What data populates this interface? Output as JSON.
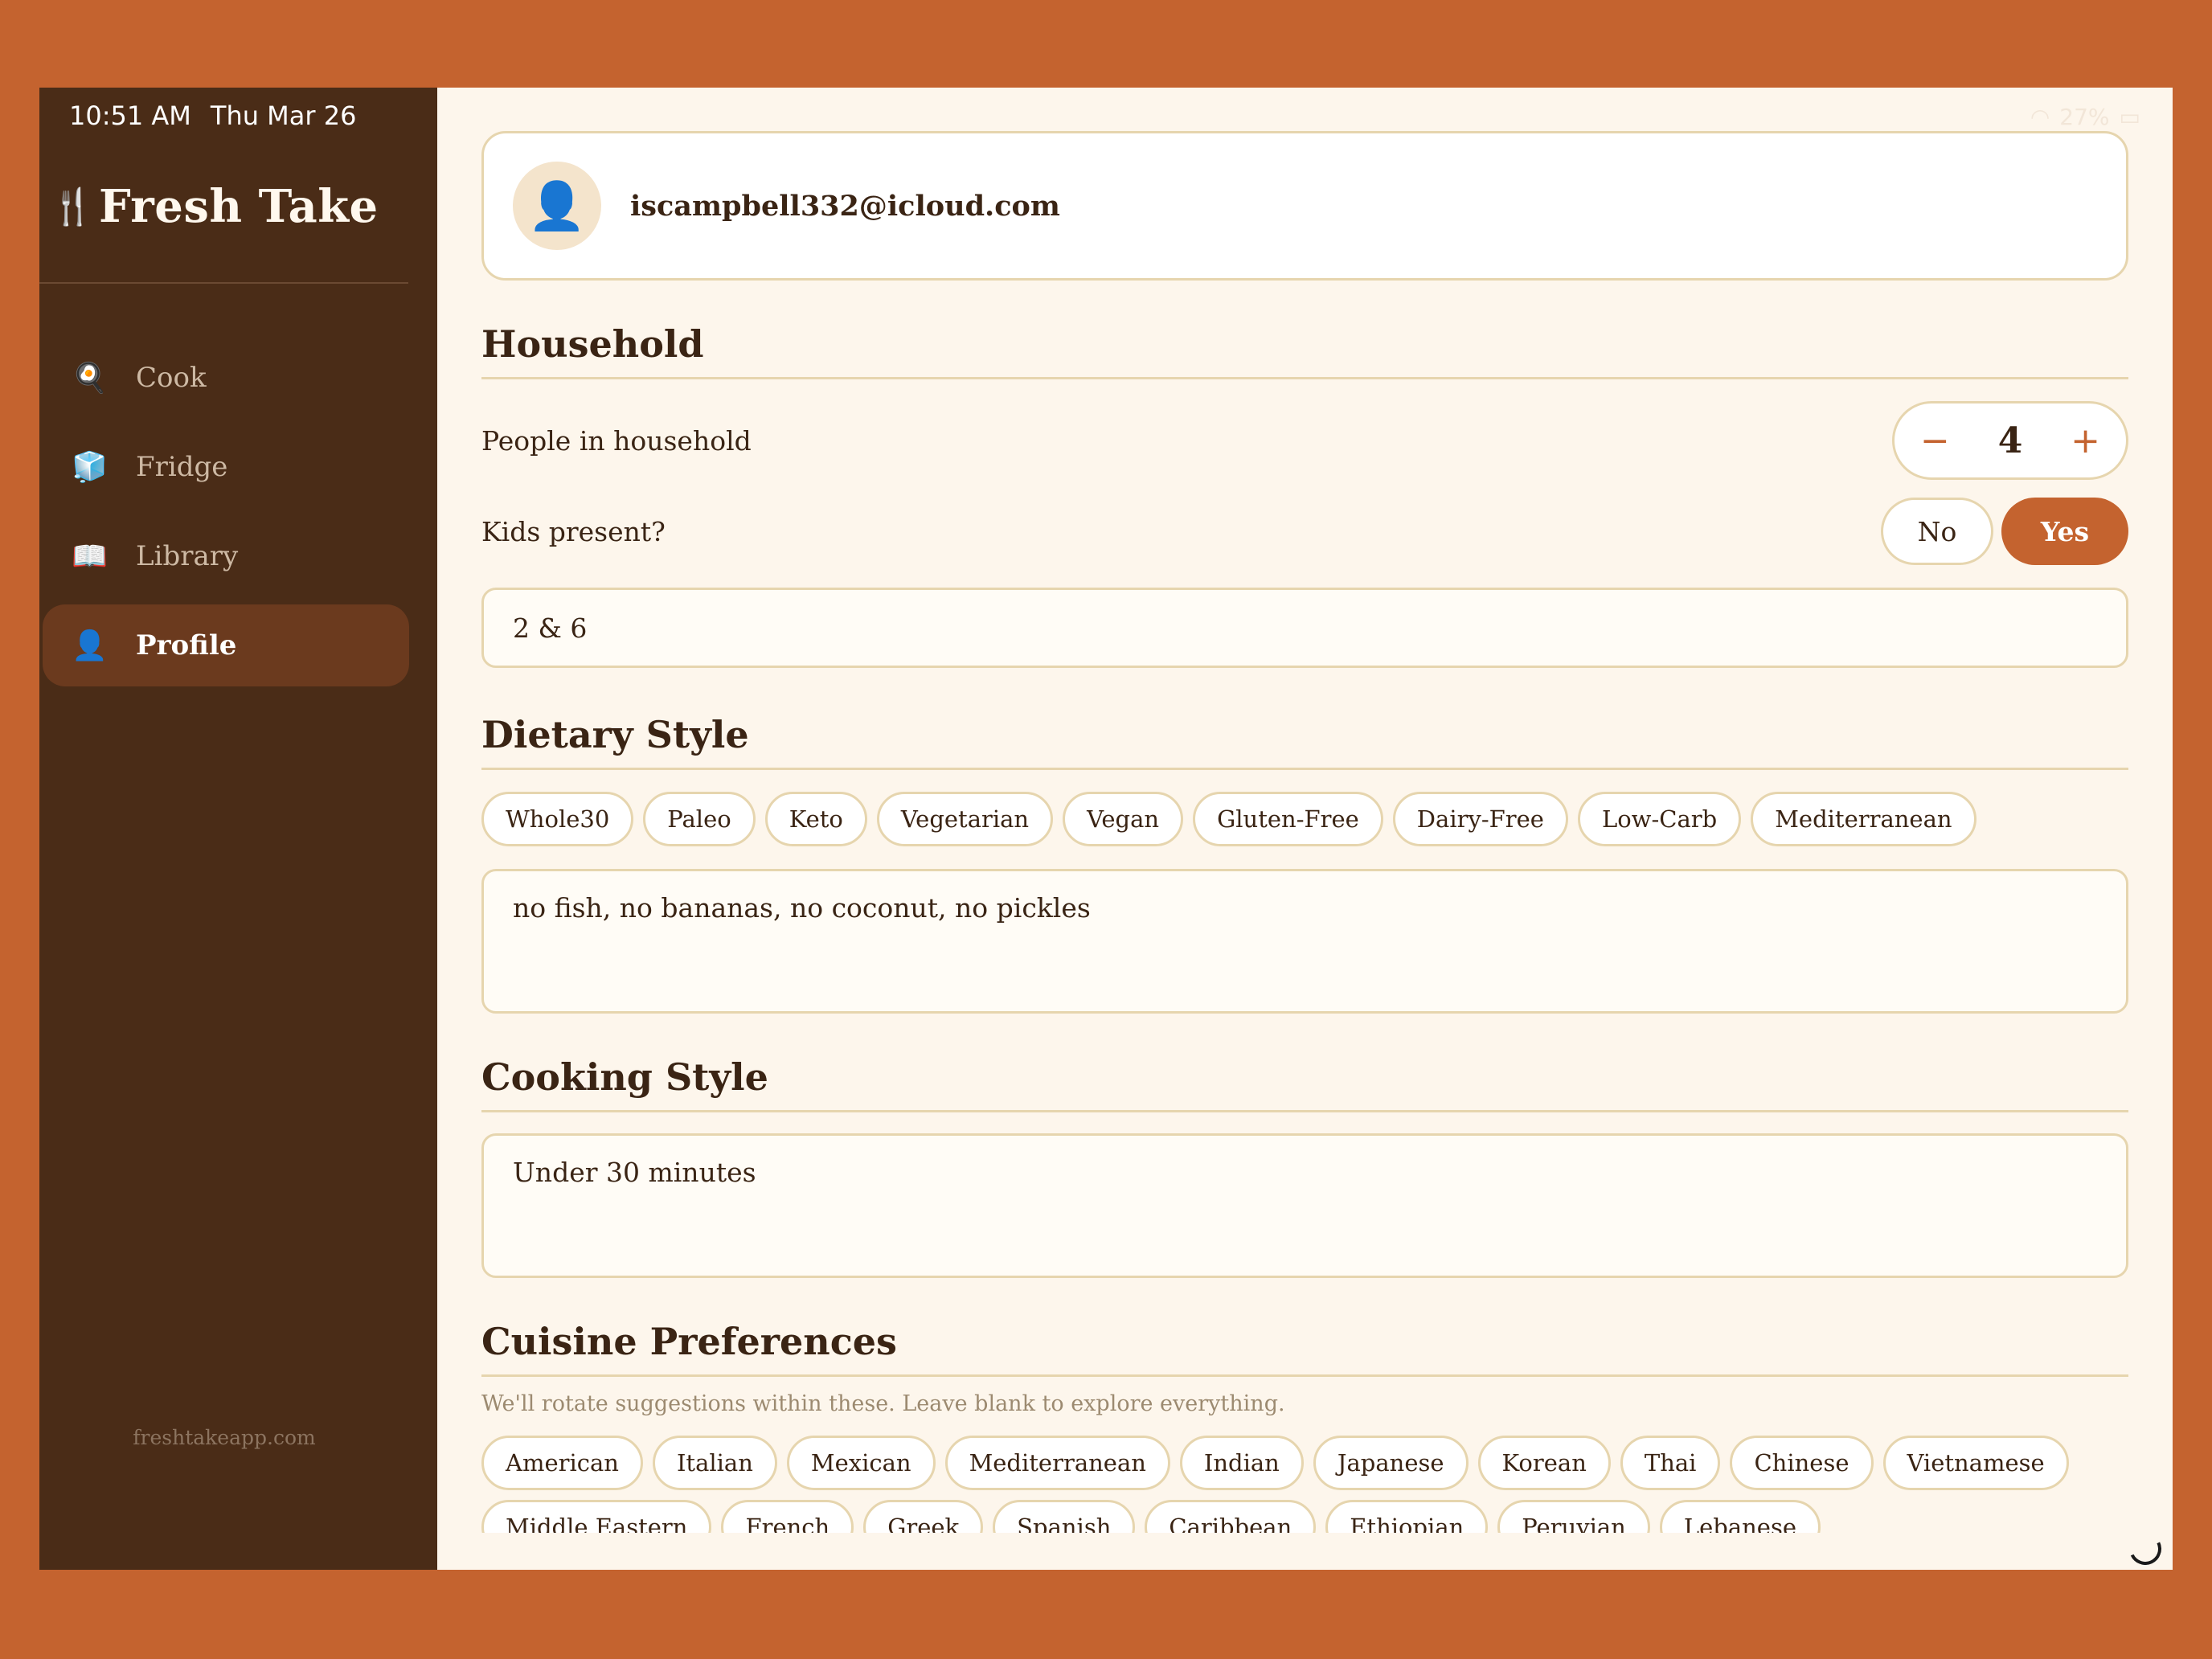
{
  "status_bar": {
    "time": "10:51 AM",
    "date": "Thu Mar 26",
    "battery": "27%"
  },
  "sidebar": {
    "brand": "Fresh Take",
    "brand_icon": "🍴",
    "items": [
      {
        "label": "Cook",
        "icon": "🍳"
      },
      {
        "label": "Fridge",
        "icon": "🧊"
      },
      {
        "label": "Library",
        "icon": "📖"
      },
      {
        "label": "Profile",
        "icon": "👤"
      }
    ],
    "footer": "freshtakeapp.com"
  },
  "account": {
    "email": "iscampbell332@icloud.com",
    "avatar_icon": "👤"
  },
  "household": {
    "title": "Household",
    "people_label": "People in household",
    "people_count": "4",
    "decrement": "−",
    "increment": "+",
    "kids_label": "Kids present?",
    "kids_no": "No",
    "kids_yes": "Yes",
    "kids_selected": "Yes",
    "kids_ages_value": "2 & 6"
  },
  "dietary": {
    "title": "Dietary Style",
    "chips": [
      "Whole30",
      "Paleo",
      "Keto",
      "Vegetarian",
      "Vegan",
      "Gluten-Free",
      "Dairy-Free",
      "Low-Carb",
      "Mediterranean"
    ],
    "notes_value": "no fish, no bananas, no coconut, no pickles"
  },
  "cooking": {
    "title": "Cooking Style",
    "value": "Under 30 minutes"
  },
  "cuisine": {
    "title": "Cuisine Preferences",
    "helper": "We'll rotate suggestions within these. Leave blank to explore everything.",
    "chips_row1": [
      "American",
      "Italian",
      "Mexican",
      "Mediterranean",
      "Indian",
      "Japanese",
      "Korean",
      "Thai",
      "Chinese",
      "Vietnamese"
    ],
    "chips_row2": [
      "Middle Eastern",
      "French",
      "Greek",
      "Spanish",
      "Caribbean",
      "Ethiopian",
      "Peruvian",
      "Lebanese"
    ]
  },
  "colors": {
    "frame": "#C4632F",
    "sidebar": "#4A2C17",
    "accent": "#C4632F",
    "background": "#FDF6EC",
    "border": "#E6D5AE"
  }
}
